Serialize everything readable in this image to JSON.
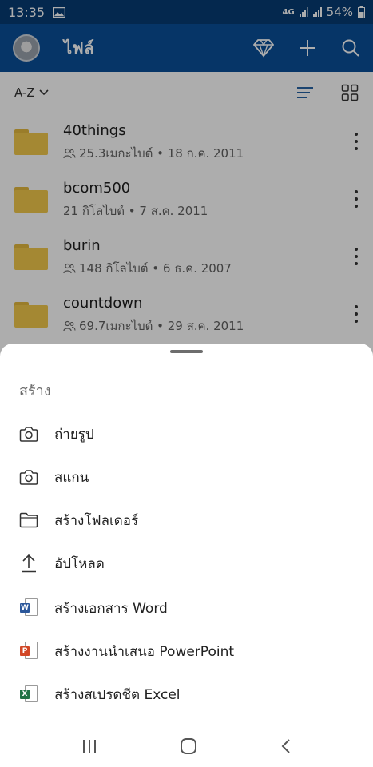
{
  "status_bar": {
    "time": "13:35",
    "network": "4G",
    "battery": "54%"
  },
  "app_bar": {
    "title": "ไฟล์"
  },
  "sort_bar": {
    "label": "A-Z"
  },
  "files": [
    {
      "name": "40things",
      "meta": "25.3เมกะไบต์ • 18 ก.ค. 2011",
      "shared": true
    },
    {
      "name": "bcom500",
      "meta": "21 กิโลไบต์ • 7 ส.ค. 2011",
      "shared": false
    },
    {
      "name": "burin",
      "meta": "148 กิโลไบต์ • 6 ธ.ค. 2007",
      "shared": true
    },
    {
      "name": "countdown",
      "meta": "69.7เมกะไบต์ • 29 ส.ค. 2011",
      "shared": true
    }
  ],
  "sheet": {
    "title": "สร้าง",
    "items": [
      {
        "label": "ถ่ายรูป",
        "icon": "camera-icon"
      },
      {
        "label": "สแกน",
        "icon": "scan-camera-icon"
      },
      {
        "label": "สร้างโฟลเดอร์",
        "icon": "folder-icon"
      },
      {
        "label": "อัปโหลด",
        "icon": "upload-icon"
      },
      {
        "label": "สร้างเอกสาร Word",
        "icon": "word-icon",
        "badge": "W"
      },
      {
        "label": "สร้างงานนำเสนอ PowerPoint",
        "icon": "powerpoint-icon",
        "badge": "P"
      },
      {
        "label": "สร้างสเปรดชีต Excel",
        "icon": "excel-icon",
        "badge": "X"
      }
    ]
  },
  "colors": {
    "app_bar": "#0a4f99",
    "status_bar": "#063b73",
    "folder": "#f2c94c",
    "word": "#2b579a",
    "powerpoint": "#d24726",
    "excel": "#217346"
  }
}
